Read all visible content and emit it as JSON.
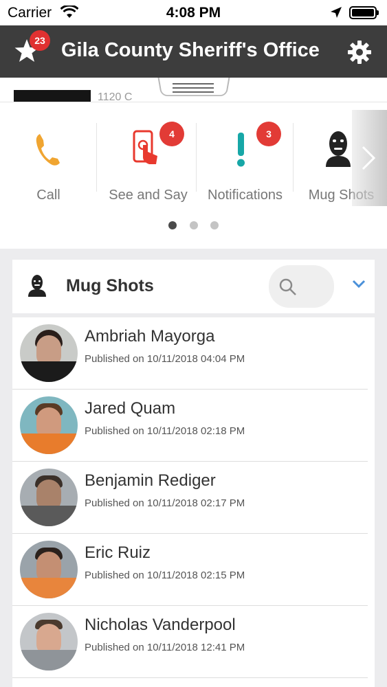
{
  "status_bar": {
    "carrier": "Carrier",
    "time": "4:08 PM"
  },
  "header": {
    "title": "Gila County Sheriff's Office",
    "favorites_badge": "23",
    "icons": [
      "star-icon",
      "gear-icon"
    ]
  },
  "strip": {
    "peek_text": "1120 C"
  },
  "quick_actions": [
    {
      "label": "Call",
      "icon": "phone-icon",
      "badge": null
    },
    {
      "label": "See and Say",
      "icon": "tap-phone-icon",
      "badge": "4"
    },
    {
      "label": "Notifications",
      "icon": "exclamation-icon",
      "badge": "3"
    },
    {
      "label": "Mug Shots",
      "icon": "masked-person-icon",
      "badge": null
    }
  ],
  "carousel": {
    "pages": 3,
    "active_page": 1
  },
  "mug_shots": {
    "title": "Mug Shots",
    "items": [
      {
        "name": "Ambriah Mayorga",
        "published": "Published on 10/11/2018 04:04 PM"
      },
      {
        "name": "Jared Quam",
        "published": "Published on 10/11/2018 02:18 PM"
      },
      {
        "name": "Benjamin Rediger",
        "published": "Published on 10/11/2018 02:17 PM"
      },
      {
        "name": "Eric Ruiz",
        "published": "Published on 10/11/2018 02:15 PM"
      },
      {
        "name": "Nicholas Vanderpool",
        "published": "Published on 10/11/2018 12:41 PM"
      }
    ]
  },
  "colors": {
    "header_bg": "#3d3d3d",
    "badge_red": "#e03131",
    "phone_orange": "#f0a531",
    "notify_teal": "#17a7a7",
    "tap_red": "#e8392e",
    "chevron_blue": "#4a90d9"
  }
}
